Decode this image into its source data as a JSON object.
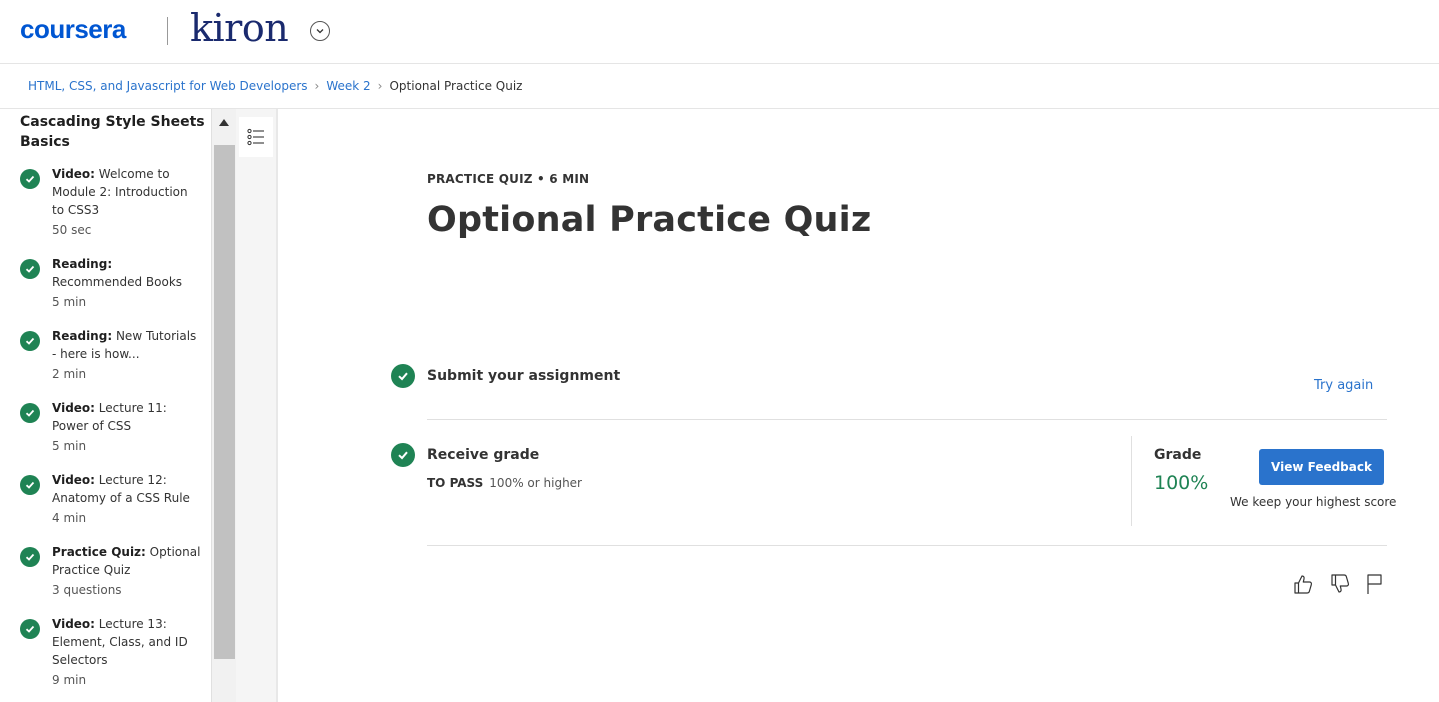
{
  "header": {
    "logo": "coursera",
    "partner_logo": "kiron",
    "partner_dropdown_icon": "chevron-down-icon"
  },
  "breadcrumb": {
    "items": [
      "HTML, CSS, and Javascript for Web Developers",
      "Week 2"
    ],
    "current": "Optional Practice Quiz",
    "separator_icon": "chevron-right-icon"
  },
  "sidebar": {
    "section_title": "Cascading Style Sheets Basics",
    "items": [
      {
        "type": "Video:",
        "title": "Welcome to Module 2: Introduction to CSS3",
        "meta": "50 sec",
        "status_icon": "check-circle-icon"
      },
      {
        "type": "Reading:",
        "title": "Recommended Books",
        "meta": "5 min",
        "status_icon": "check-circle-icon"
      },
      {
        "type": "Reading:",
        "title": "New Tutorials - here is how...",
        "meta": "2 min",
        "status_icon": "check-circle-icon"
      },
      {
        "type": "Video:",
        "title": "Lecture 11: Power of CSS",
        "meta": "5 min",
        "status_icon": "check-circle-icon"
      },
      {
        "type": "Video:",
        "title": "Lecture 12: Anatomy of a CSS Rule",
        "meta": "4 min",
        "status_icon": "check-circle-icon"
      },
      {
        "type": "Practice Quiz:",
        "title": "Optional Practice Quiz",
        "meta": "3 questions",
        "status_icon": "check-circle-icon"
      },
      {
        "type": "Video:",
        "title": "Lecture 13: Element, Class, and ID Selectors",
        "meta": "9 min",
        "status_icon": "check-circle-icon"
      }
    ]
  },
  "rail": {
    "icon": "list-icon"
  },
  "main": {
    "meta_line": "PRACTICE QUIZ • 6 MIN",
    "title": "Optional Practice Quiz",
    "submit": {
      "label": "Submit your assignment",
      "try_again": "Try again"
    },
    "receive": {
      "label": "Receive grade",
      "to_pass_label": "TO PASS",
      "to_pass_value": "100% or higher"
    },
    "grade": {
      "label": "Grade",
      "value": "100%",
      "button": "View Feedback",
      "note": "We keep your highest score"
    }
  },
  "colors": {
    "accent": "#2a73cc",
    "success": "#1f8354",
    "brand": "#0056d2"
  }
}
